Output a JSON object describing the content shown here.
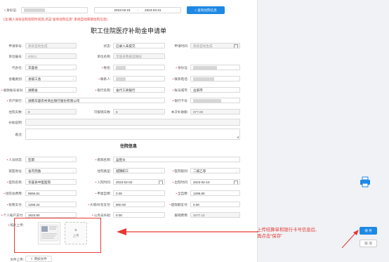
{
  "search": {
    "idcard_label": "身份证:",
    "date_start": "2023-02-01",
    "date_sep": "-",
    "date_end": "2023-03-31",
    "query_button": "查询住院信息",
    "notice": "(注:输入身份证和住院时间后,点击\"查询住院信息\",系统自动获取住院信息)"
  },
  "form": {
    "title": "职工住院医疗补助金申请单",
    "rows": {
      "applicant_no_label": "申请单号:",
      "applicant_no_value": "系统自动生成",
      "status_label": "状态:",
      "status_value": "已录入未提交",
      "apply_time_label": "申请时间:",
      "apply_time_value": "系统自动生成",
      "unit_no_label": "单位编号:",
      "unit_no_value": "sfl001",
      "unit_name_label": "单位名称:",
      "unit_name_value": "华容县救援运输站",
      "agent_label": "代办社:",
      "agent_value": "华容县",
      "name_label": "姓名:",
      "idcard_label": "身份证:",
      "type_label": "会籍类别:",
      "type_value": "县级工会",
      "contact_label": "联系人:",
      "phone_label": "联系电话:",
      "bank_province_label": "收款账号省份:",
      "bank_province_value": "湖南省",
      "bank_label": "银行名称:",
      "bank_value": "省代工商银行",
      "bank_city_label": "账号城市:",
      "bank_city_value": "岳阳市",
      "account_label": "开户银行:",
      "account_value": "湖南华容农村商业银行股份有限公司",
      "card_label": "银行卡号:",
      "days_label": "住院天数:",
      "days_value": "8",
      "allow_days_label": "可报销天数:",
      "allow_days_value": "8",
      "amount_label": "本次补助额:",
      "amount_value": "377.00",
      "desc_label": "补助说明:",
      "remark_label": "备注:"
    }
  },
  "hospital": {
    "title": "住院信息",
    "person_status_label": "人员状态:",
    "person_status_value": "在职",
    "disease_label": "疾病名称:",
    "disease_value": "盆腔炎",
    "insurance_label": "就医地址:",
    "insurance_value": "省内完备",
    "in_type_label": "住院类型:",
    "in_type_value": "城镇职工",
    "hosp_level_label": "医院级别:",
    "hosp_level_value": "二级乙等",
    "hosp_name_label": "医院名称:",
    "hosp_name_value": "华容县中医医院",
    "in_date_label": "入院时间:",
    "in_date_value": "2023-02-02",
    "out_date_label": "出院时间:",
    "out_date_value": "2023-02-10",
    "total_label": "住院总费用:",
    "total_value": "6556.81",
    "self_label": "甲类自费:",
    "self_value": "0.00",
    "self_pay_label": "全自费:",
    "self_pay_value": "1296.80",
    "fund_label": "统筹支付:",
    "fund_value": "1259.24",
    "big_label": "大病/补充支付:",
    "big_value": "800.00",
    "over_label": "超限额支付:",
    "over_value": "0.00",
    "personal_label": "个人账户支付:",
    "personal_value": "1623.60",
    "civil_label": "公务员补助:",
    "civil_value": "0.00",
    "reimb_label": "报销费用:",
    "reimb_value": "1077.12",
    "photo_label": "照片上传:",
    "upload_plus": "+",
    "upload_text": "上传",
    "file_label": "文件上传:",
    "add_file": "添加文件"
  },
  "annotation": {
    "line1": "上传结算单和银行卡号信息后,",
    "line2": "再点击“保存”"
  },
  "actions": {
    "save": "保 存",
    "cancel": "取 消"
  },
  "colors": {
    "accent": "#1e88e5",
    "annotation": "#e53935"
  }
}
